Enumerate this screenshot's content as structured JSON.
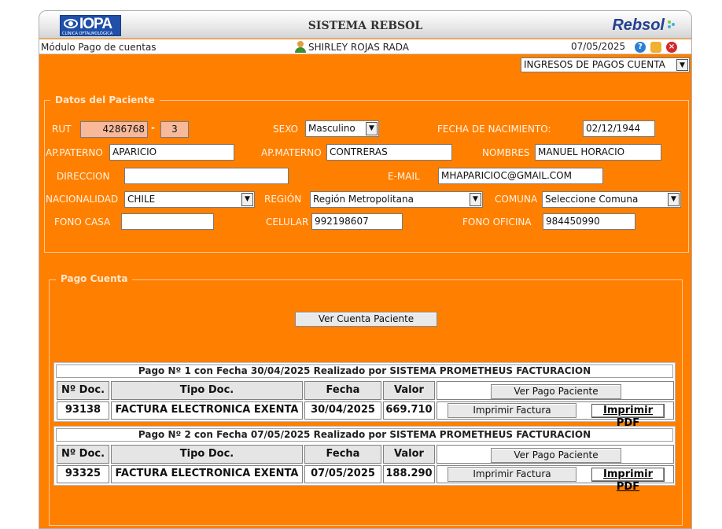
{
  "header": {
    "logo_left": "IOPA",
    "logo_left_sub": "CLÍNICA OFTALMOLÓGICA",
    "title": "SISTEMA REBSOL",
    "logo_right": "Rebsol",
    "accent": "#ff7f00",
    "brand_blue": "#1f4fa8"
  },
  "bar": {
    "module": "Módulo Pago de cuentas",
    "user": "SHIRLEY ROJAS RADA",
    "date": "07/05/2025",
    "icons": [
      "help-icon",
      "lock-icon",
      "close-icon"
    ],
    "menu_select": "INGRESOS DE PAGOS CUENTA"
  },
  "patient": {
    "legend": "Datos del Paciente",
    "rut_label": "RUT",
    "rut": "4286768",
    "dash": "-",
    "dv": "3",
    "sexo_label": "SEXO",
    "sexo": "Masculino",
    "nac_label": "FECHA DE NACIMIENTO:",
    "nac": "02/12/1944",
    "ap_paterno_label": "AP.PATERNO",
    "ap_paterno": "APARICIO",
    "ap_materno_label": "AP.MATERNO",
    "ap_materno": "CONTRERAS",
    "nombres_label": "NOMBRES",
    "nombres": "MANUEL HORACIO",
    "direccion_label": "DIRECCION",
    "direccion": "",
    "email_label": "E-MAIL",
    "email": "MHAPARICIOC@GMAIL.COM",
    "nacionalidad_label": "NACIONALIDAD",
    "nacionalidad": "CHILE",
    "region_label": "REGIÓN",
    "region": "Región Metropolitana",
    "comuna_label": "COMUNA",
    "comuna": "Seleccione Comuna",
    "fono_casa_label": "FONO CASA",
    "fono_casa": "",
    "celular_label": "CELULAR",
    "celular": "992198607",
    "fono_oficina_label": "FONO OFICINA",
    "fono_oficina": "984450990"
  },
  "pago": {
    "legend": "Pago Cuenta",
    "ver_cuenta": "Ver Cuenta Paciente",
    "columns": [
      "Nº Doc.",
      "Tipo Doc.",
      "Fecha",
      "Valor"
    ],
    "ver_pago": "Ver Pago Paciente",
    "imprimir_factura": "Imprimir Factura",
    "imprimir_pdf": "Imprimir PDF",
    "pagos": [
      {
        "title": "Pago Nº 1 con Fecha 30/04/2025 Realizado por SISTEMA PROMETHEUS FACTURACION",
        "doc": "93138",
        "tipo": "FACTURA ELECTRONICA EXENTA",
        "fecha": "30/04/2025",
        "valor": "669.710"
      },
      {
        "title": "Pago Nº 2 con Fecha 07/05/2025 Realizado por SISTEMA PROMETHEUS FACTURACION",
        "doc": "93325",
        "tipo": "FACTURA ELECTRONICA EXENTA",
        "fecha": "07/05/2025",
        "valor": "188.290"
      }
    ]
  }
}
